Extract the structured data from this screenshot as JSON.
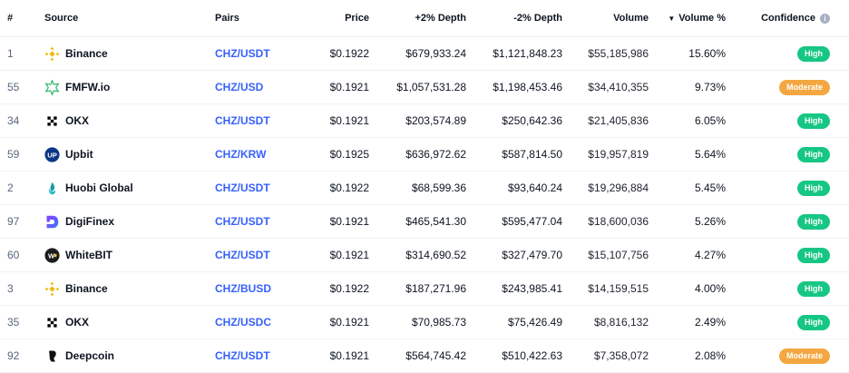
{
  "colors": {
    "link": "#3861fb",
    "high": "#16c784",
    "moderate": "#f3a740",
    "muted": "#58667e"
  },
  "header": {
    "rank": "#",
    "source": "Source",
    "pairs": "Pairs",
    "price": "Price",
    "plus_depth": "+2% Depth",
    "minus_depth": "-2% Depth",
    "volume": "Volume",
    "volume_pct": "Volume %",
    "volume_pct_sort_icon": "sort-desc-icon",
    "confidence": "Confidence",
    "confidence_info_icon": "info-icon"
  },
  "rows": [
    {
      "rank": "1",
      "source": "Binance",
      "logo": "binance-logo",
      "pair": "CHZ/USDT",
      "price": "$0.1922",
      "plus_depth": "$679,933.24",
      "minus_depth": "$1,121,848.23",
      "volume": "$55,185,986",
      "volume_pct": "15.60%",
      "confidence": "High"
    },
    {
      "rank": "55",
      "source": "FMFW.io",
      "logo": "fmfw-logo",
      "pair": "CHZ/USD",
      "price": "$0.1921",
      "plus_depth": "$1,057,531.28",
      "minus_depth": "$1,198,453.46",
      "volume": "$34,410,355",
      "volume_pct": "9.73%",
      "confidence": "Moderate"
    },
    {
      "rank": "34",
      "source": "OKX",
      "logo": "okx-logo",
      "pair": "CHZ/USDT",
      "price": "$0.1921",
      "plus_depth": "$203,574.89",
      "minus_depth": "$250,642.36",
      "volume": "$21,405,836",
      "volume_pct": "6.05%",
      "confidence": "High"
    },
    {
      "rank": "59",
      "source": "Upbit",
      "logo": "upbit-logo",
      "pair": "CHZ/KRW",
      "price": "$0.1925",
      "plus_depth": "$636,972.62",
      "minus_depth": "$587,814.50",
      "volume": "$19,957,819",
      "volume_pct": "5.64%",
      "confidence": "High"
    },
    {
      "rank": "2",
      "source": "Huobi Global",
      "logo": "huobi-logo",
      "pair": "CHZ/USDT",
      "price": "$0.1922",
      "plus_depth": "$68,599.36",
      "minus_depth": "$93,640.24",
      "volume": "$19,296,884",
      "volume_pct": "5.45%",
      "confidence": "High"
    },
    {
      "rank": "97",
      "source": "DigiFinex",
      "logo": "digifinex-logo",
      "pair": "CHZ/USDT",
      "price": "$0.1921",
      "plus_depth": "$465,541.30",
      "minus_depth": "$595,477.04",
      "volume": "$18,600,036",
      "volume_pct": "5.26%",
      "confidence": "High"
    },
    {
      "rank": "60",
      "source": "WhiteBIT",
      "logo": "whitebit-logo",
      "pair": "CHZ/USDT",
      "price": "$0.1921",
      "plus_depth": "$314,690.52",
      "minus_depth": "$327,479.70",
      "volume": "$15,107,756",
      "volume_pct": "4.27%",
      "confidence": "High"
    },
    {
      "rank": "3",
      "source": "Binance",
      "logo": "binance-logo",
      "pair": "CHZ/BUSD",
      "price": "$0.1922",
      "plus_depth": "$187,271.96",
      "minus_depth": "$243,985.41",
      "volume": "$14,159,515",
      "volume_pct": "4.00%",
      "confidence": "High"
    },
    {
      "rank": "35",
      "source": "OKX",
      "logo": "okx-logo",
      "pair": "CHZ/USDC",
      "price": "$0.1921",
      "plus_depth": "$70,985.73",
      "minus_depth": "$75,426.49",
      "volume": "$8,816,132",
      "volume_pct": "2.49%",
      "confidence": "High"
    },
    {
      "rank": "92",
      "source": "Deepcoin",
      "logo": "deepcoin-logo",
      "pair": "CHZ/USDT",
      "price": "$0.1921",
      "plus_depth": "$564,745.42",
      "minus_depth": "$510,422.63",
      "volume": "$7,358,072",
      "volume_pct": "2.08%",
      "confidence": "Moderate"
    }
  ]
}
